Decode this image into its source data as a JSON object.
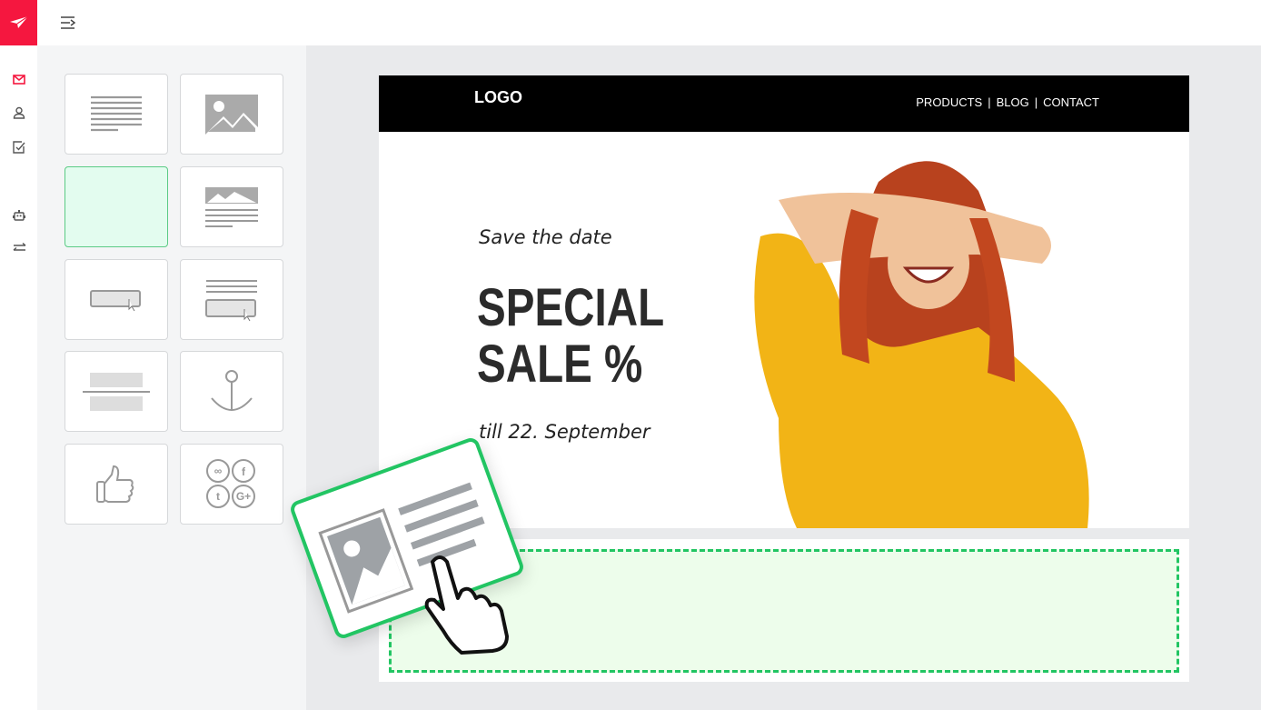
{
  "app": {
    "brand_icon": "paper-plane-icon",
    "menu_icon": "menu-collapse-icon",
    "accent": "#f5173f"
  },
  "rail": {
    "items": [
      {
        "icon": "mail-icon",
        "active": true
      },
      {
        "icon": "user-icon"
      },
      {
        "icon": "checkbox-icon"
      },
      {
        "icon": "robot-icon"
      },
      {
        "icon": "sync-arrows-icon"
      }
    ]
  },
  "blocks": [
    "text",
    "image",
    "empty",
    "image-text",
    "button",
    "text-button",
    "divider",
    "anchor",
    "like",
    "social"
  ],
  "email": {
    "logo": "LOGO",
    "nav": [
      "PRODUCTS",
      "BLOG",
      "CONTACT"
    ],
    "kicker": "Save the date",
    "headline1": "SPECIAL",
    "headline2": "SALE %",
    "date": "till 22. September"
  },
  "colors": {
    "drop_border": "#22c563",
    "drop_fill": "#edfdeb",
    "selected_tile": "#e3fcef"
  }
}
